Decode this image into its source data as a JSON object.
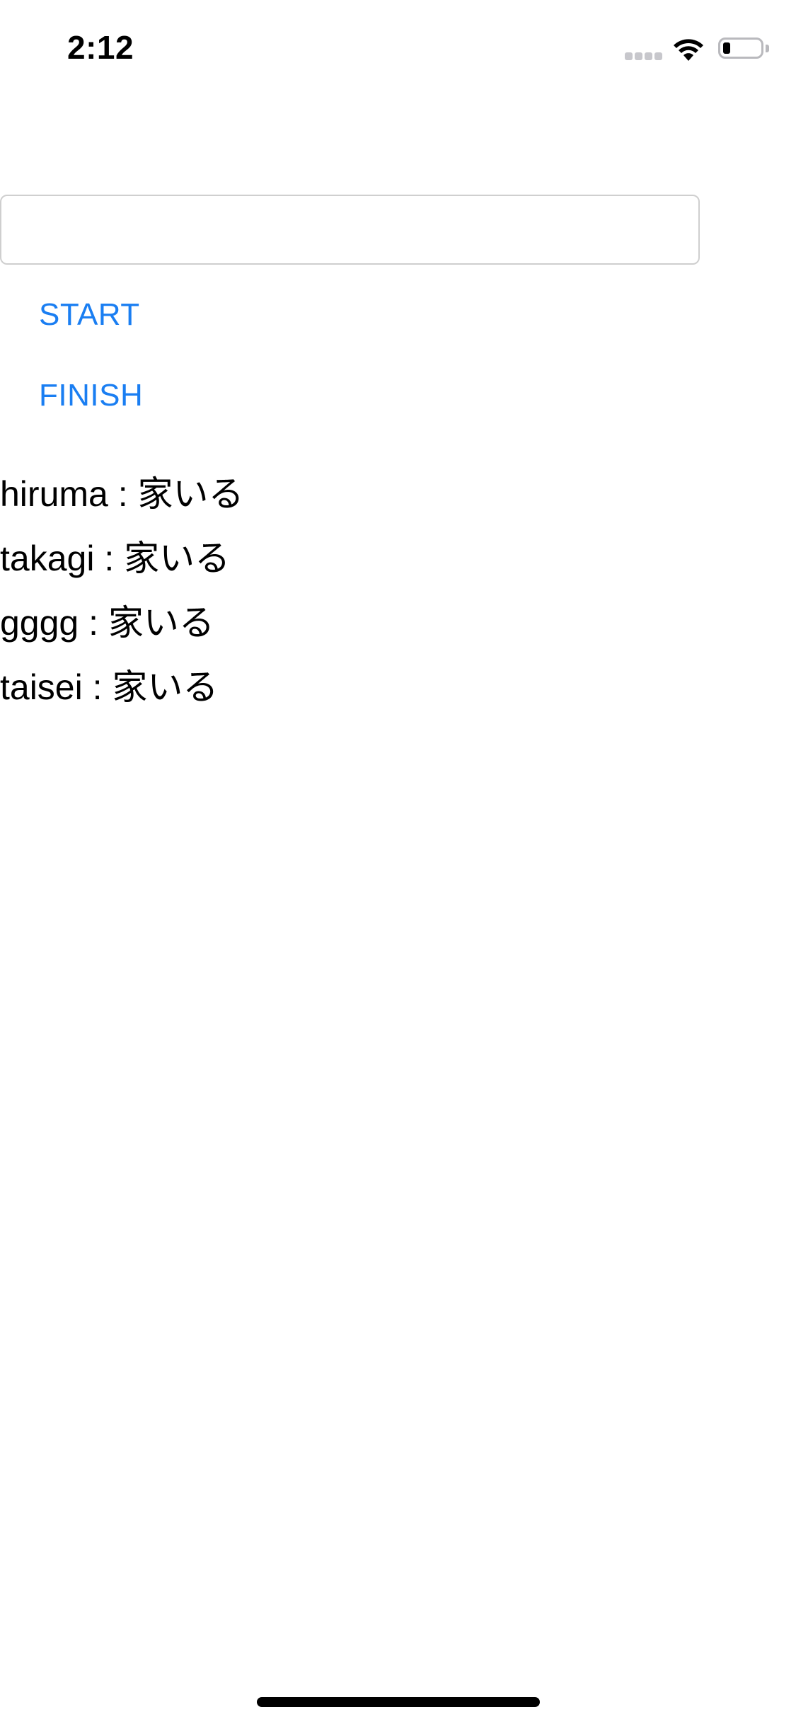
{
  "status_bar": {
    "time": "2:12",
    "signal_icon": "cellular-signal-icon",
    "wifi_icon": "wifi-icon",
    "battery_icon": "battery-icon",
    "battery_level": 0.2
  },
  "form": {
    "text_field_value": "",
    "text_field_placeholder": "",
    "start_label": "START",
    "finish_label": "FINISH",
    "button_color": "#1a7ef2"
  },
  "list": {
    "items": [
      "hiruma : 家いる",
      "takagi : 家いる",
      "gggg : 家いる",
      "taisei : 家いる"
    ]
  }
}
